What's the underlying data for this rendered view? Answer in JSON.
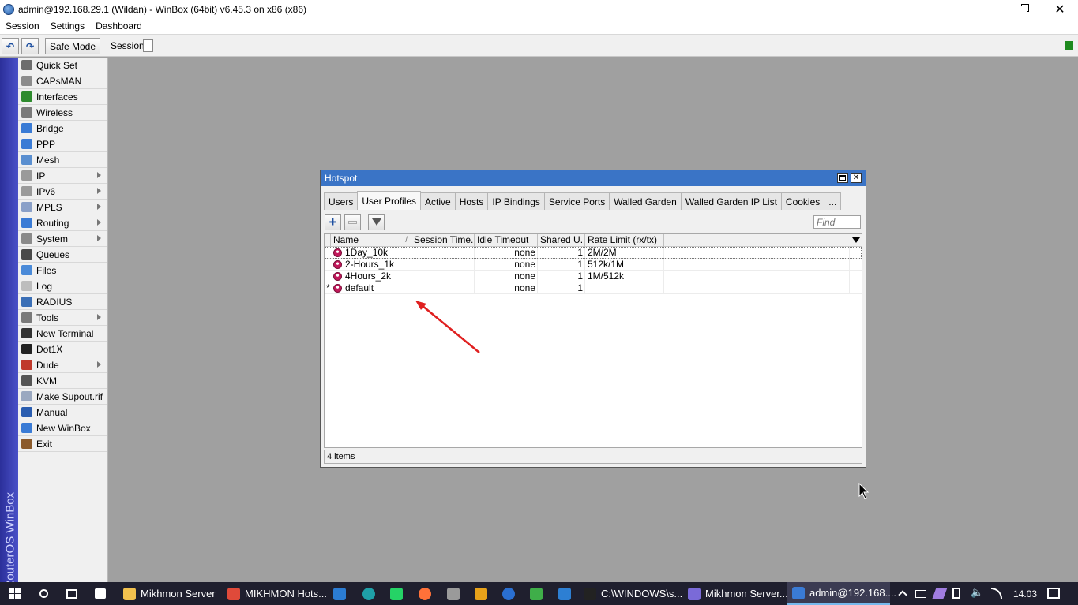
{
  "window": {
    "title": "admin@192.168.29.1 (Wildan) - WinBox (64bit) v6.45.3 on x86 (x86)",
    "minimize_icon": "minimize-icon",
    "restore_icon": "restore-icon",
    "close_icon": "close-icon"
  },
  "menubar": [
    "Session",
    "Settings",
    "Dashboard"
  ],
  "toolbar": {
    "undo_icon": "undo-icon",
    "redo_icon": "redo-icon",
    "safe_mode_label": "Safe Mode",
    "session_label": "Session:"
  },
  "side_strip_text": "RouterOS WinBox",
  "sidebar": {
    "items": [
      {
        "label": "Quick Set",
        "icon": "quick-set-icon",
        "color": "#6d6d6d",
        "submenu": false
      },
      {
        "label": "CAPsMAN",
        "icon": "capsman-icon",
        "color": "#8c8c8c",
        "submenu": false
      },
      {
        "label": "Interfaces",
        "icon": "interfaces-icon",
        "color": "#2e8b2e",
        "submenu": false
      },
      {
        "label": "Wireless",
        "icon": "wireless-icon",
        "color": "#7a7a7a",
        "submenu": false
      },
      {
        "label": "Bridge",
        "icon": "bridge-icon",
        "color": "#3a7bd5",
        "submenu": false
      },
      {
        "label": "PPP",
        "icon": "ppp-icon",
        "color": "#3a7bd5",
        "submenu": false
      },
      {
        "label": "Mesh",
        "icon": "mesh-icon",
        "color": "#5a8fd0",
        "submenu": false
      },
      {
        "label": "IP",
        "icon": "ip-icon",
        "color": "#9a9a9a",
        "submenu": true
      },
      {
        "label": "IPv6",
        "icon": "ipv6-icon",
        "color": "#9a9a9a",
        "submenu": true
      },
      {
        "label": "MPLS",
        "icon": "mpls-icon",
        "color": "#8aa0c8",
        "submenu": true
      },
      {
        "label": "Routing",
        "icon": "routing-icon",
        "color": "#3a7bd5",
        "submenu": true
      },
      {
        "label": "System",
        "icon": "system-icon",
        "color": "#8a8a8a",
        "submenu": true
      },
      {
        "label": "Queues",
        "icon": "queues-icon",
        "color": "#4a4a4a",
        "submenu": false
      },
      {
        "label": "Files",
        "icon": "files-icon",
        "color": "#4a8ad8",
        "submenu": false
      },
      {
        "label": "Log",
        "icon": "log-icon",
        "color": "#bdbdbd",
        "submenu": false
      },
      {
        "label": "RADIUS",
        "icon": "radius-icon",
        "color": "#3b6fb6",
        "submenu": false
      },
      {
        "label": "Tools",
        "icon": "tools-icon",
        "color": "#7a7a7a",
        "submenu": true
      },
      {
        "label": "New Terminal",
        "icon": "terminal-icon",
        "color": "#333333",
        "submenu": false
      },
      {
        "label": "Dot1X",
        "icon": "dot1x-icon",
        "color": "#222222",
        "submenu": false
      },
      {
        "label": "Dude",
        "icon": "dude-icon",
        "color": "#c0392b",
        "submenu": true
      },
      {
        "label": "KVM",
        "icon": "kvm-icon",
        "color": "#555555",
        "submenu": false
      },
      {
        "label": "Make Supout.rif",
        "icon": "supout-icon",
        "color": "#9aa8c0",
        "submenu": false
      },
      {
        "label": "Manual",
        "icon": "manual-icon",
        "color": "#2a5db0",
        "submenu": false
      },
      {
        "label": "New WinBox",
        "icon": "winbox-icon",
        "color": "#3a7bd5",
        "submenu": false
      },
      {
        "label": "Exit",
        "icon": "exit-icon",
        "color": "#8b5a2b",
        "submenu": false
      }
    ]
  },
  "hotspot": {
    "title": "Hotspot",
    "tabs": [
      "Users",
      "User Profiles",
      "Active",
      "Hosts",
      "IP Bindings",
      "Service Ports",
      "Walled Garden",
      "Walled Garden IP List",
      "Cookies",
      "..."
    ],
    "active_tab": "User Profiles",
    "find_placeholder": "Find",
    "columns": [
      "Name",
      "Session Time...",
      "Idle Timeout",
      "Shared U...",
      "Rate Limit (rx/tx)"
    ],
    "rows": [
      {
        "marker": "",
        "name": "1Day_10k",
        "session_timeout": "",
        "idle_timeout": "none",
        "shared_users": "1",
        "rate_limit": "2M/2M"
      },
      {
        "marker": "",
        "name": "2-Hours_1k",
        "session_timeout": "",
        "idle_timeout": "none",
        "shared_users": "1",
        "rate_limit": "512k/1M"
      },
      {
        "marker": "",
        "name": "4Hours_2k",
        "session_timeout": "",
        "idle_timeout": "none",
        "shared_users": "1",
        "rate_limit": "1M/512k"
      },
      {
        "marker": "*",
        "name": "default",
        "session_timeout": "",
        "idle_timeout": "none",
        "shared_users": "1",
        "rate_limit": ""
      }
    ],
    "status": "4 items",
    "annotation_color": "#e02020"
  },
  "taskbar": {
    "items": [
      {
        "label": "Mikhmon Server",
        "icon": "folder-icon",
        "color": "#f2c14e"
      },
      {
        "label": "MIKHMON Hots...",
        "icon": "chrome-icon",
        "color": "#e04a3a"
      },
      {
        "label": "C:\\WINDOWS\\s...",
        "icon": "cmd-icon",
        "color": "#222222"
      },
      {
        "label": "Mikhmon Server...",
        "icon": "mikhmon-icon",
        "color": "#7a6ad8"
      },
      {
        "label": "admin@192.168....",
        "icon": "winbox-task-icon",
        "color": "#3a7bd5"
      }
    ],
    "clock": "14.03"
  }
}
